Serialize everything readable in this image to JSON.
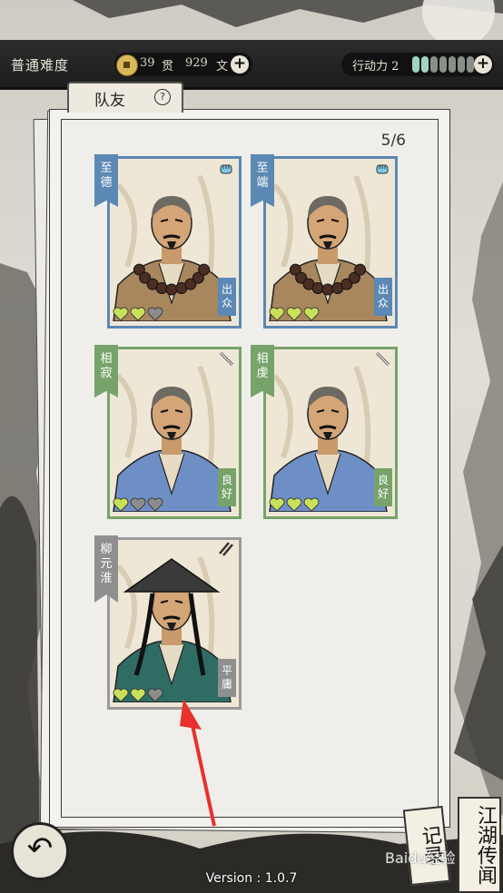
{
  "header": {
    "difficulty": "普通难度",
    "guan_amount": "39",
    "guan_unit": "贯",
    "wen_amount": "929",
    "wen_unit": "文",
    "action_label": "行动力 2",
    "action_points_current": 2,
    "action_points_max": 7
  },
  "tab": {
    "title": "队友"
  },
  "team": {
    "count": "5/6",
    "members": [
      {
        "name": "至德",
        "quality": "出众",
        "rarity": "blue",
        "hearts_filled": 2,
        "hearts_total": 3,
        "badge_icon": "fist-icon"
      },
      {
        "name": "至端",
        "quality": "出众",
        "rarity": "blue",
        "hearts_filled": 3,
        "hearts_total": 3,
        "badge_icon": "fist-icon"
      },
      {
        "name": "相寂",
        "quality": "良好",
        "rarity": "green",
        "hearts_filled": 1,
        "hearts_total": 3,
        "badge_icon": "staff-icon"
      },
      {
        "name": "相虔",
        "quality": "良好",
        "rarity": "green",
        "hearts_filled": 3,
        "hearts_total": 3,
        "badge_icon": "staff-icon"
      },
      {
        "name": "柳元淮",
        "quality": "平庸",
        "rarity": "grey",
        "hearts_filled": 2,
        "hearts_total": 3,
        "badge_icon": "dual-swords-icon"
      }
    ]
  },
  "footer": {
    "version": "Version : 1.0.7",
    "journal_label": "记录",
    "rumors_label": "江湖传闻",
    "watermark": "Baidu经验"
  },
  "colors": {
    "blue": "#5b88b4",
    "green": "#76a36a",
    "grey": "#8f8f8f",
    "heart_on": "#c8e05a",
    "heart_off": "#8c8c8c",
    "arrow": "#e8312b"
  }
}
